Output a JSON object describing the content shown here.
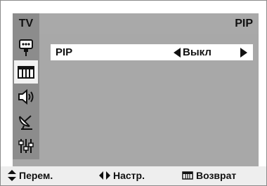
{
  "header": {
    "source_badge": "TV",
    "title": "PIP"
  },
  "sidebar": {
    "icons": [
      "remote-input-icon",
      "picture-icon",
      "sound-icon",
      "antenna-icon",
      "setup-icon"
    ],
    "active_index": 1
  },
  "menu": {
    "rows": [
      {
        "label": "PIP",
        "value": "Выкл",
        "selected": true
      }
    ]
  },
  "footer": {
    "move_label": "Перем.",
    "adjust_label": "Настр.",
    "return_label": "Возврат"
  },
  "colors": {
    "panel": "#a8a8a8",
    "sidebar": "#8c8c8c",
    "highlight": "#ffffff",
    "footer": "#eeeeee"
  }
}
